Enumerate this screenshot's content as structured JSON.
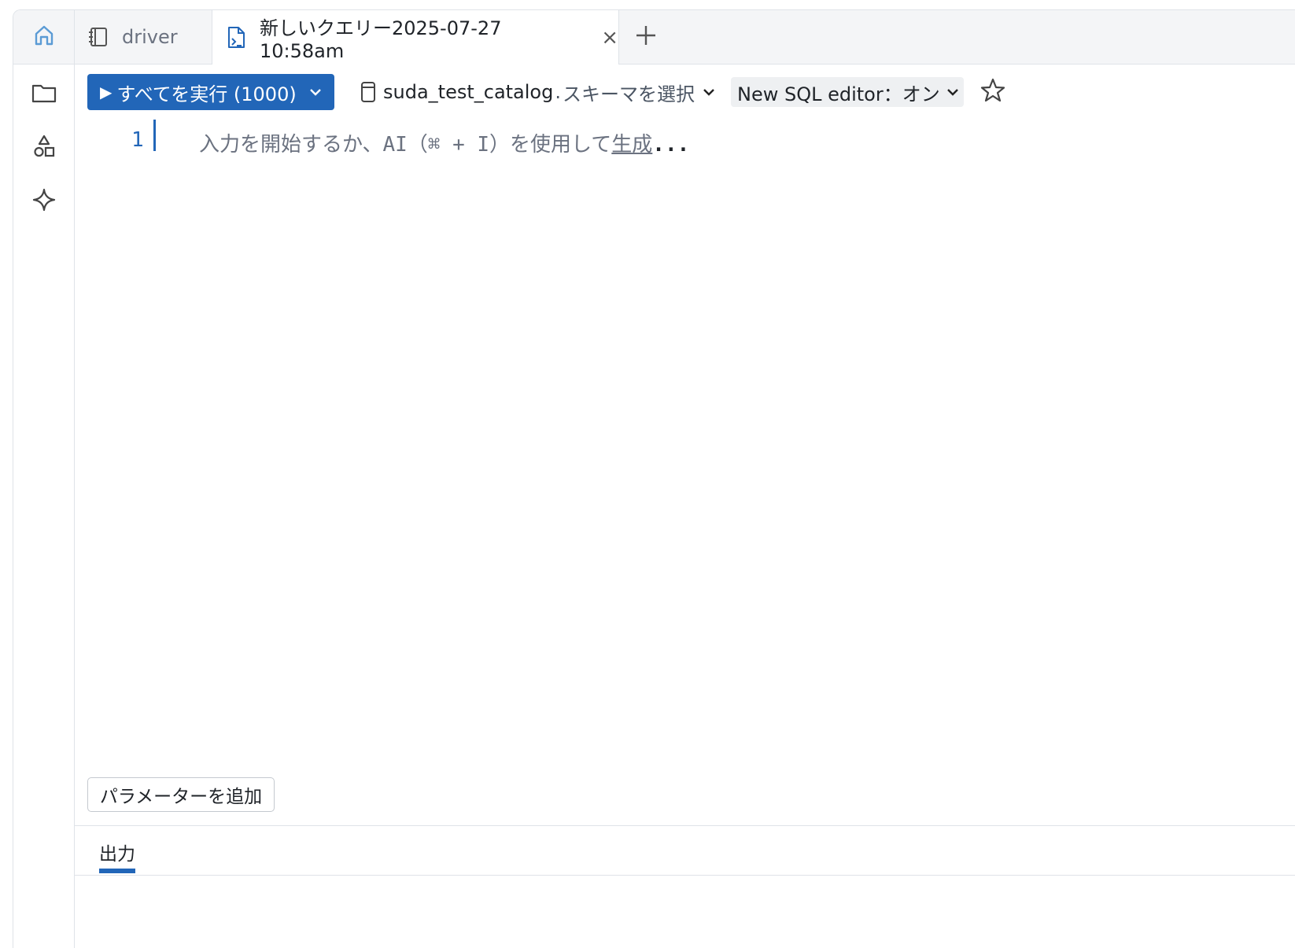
{
  "tabs": {
    "driver_label": "driver",
    "active_label": "新しいクエリー2025-07-27 10:58am",
    "close_glyph": "×"
  },
  "toolbar": {
    "run_label": "すべてを実行 (1000)",
    "catalog_name": "suda_test_catalog",
    "separator": ".",
    "schema_placeholder": "スキーマを選択",
    "editor_toggle_label": "New SQL editor：オン"
  },
  "editor": {
    "line_number": "1",
    "placeholder_text": "入力を開始するか、AI（⌘ + I）を使用して",
    "placeholder_link": "生成",
    "placeholder_dots": "..."
  },
  "parameters": {
    "add_label": "パラメーターを追加"
  },
  "output": {
    "tab_label": "出力"
  },
  "colors": {
    "accent": "#2266b8",
    "home_icon": "#5b9bd5"
  },
  "icons": {
    "home": "home-icon",
    "notebook": "notebook-icon",
    "query_file": "query-file-icon",
    "add": "plus-icon",
    "folder": "folder-icon",
    "shapes": "shapes-icon",
    "assistant": "sparkle-icon",
    "database": "database-icon",
    "star": "star-icon"
  }
}
